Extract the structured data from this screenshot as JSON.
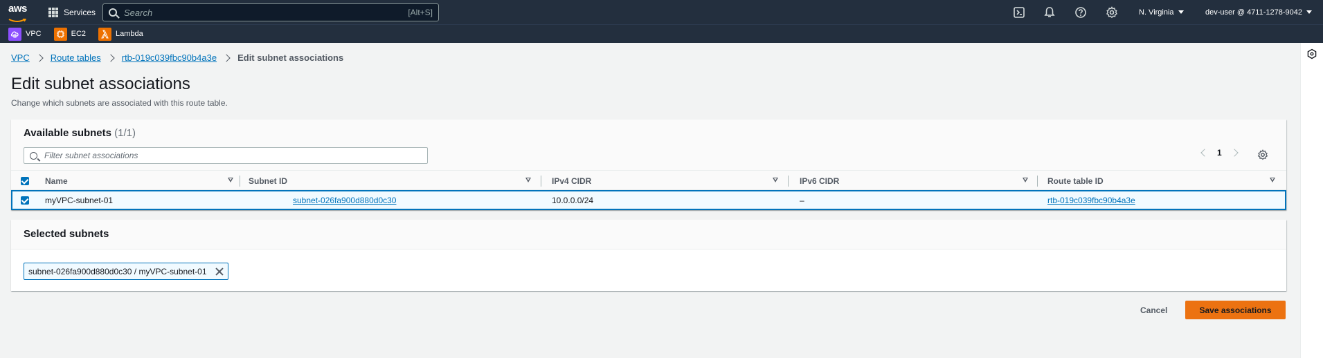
{
  "topnav": {
    "logo_text": "aws",
    "services_label": "Services",
    "search_placeholder": "Search",
    "search_shortcut": "[Alt+S]",
    "region": "N. Virginia",
    "account": "dev-user @ 4711-1278-9042"
  },
  "favorites": [
    {
      "label": "VPC",
      "color": "#8c4fff",
      "icon": "vpc-icon"
    },
    {
      "label": "EC2",
      "color": "#ed7100",
      "icon": "ec2-icon"
    },
    {
      "label": "Lambda",
      "color": "#ed7100",
      "icon": "lambda-icon"
    }
  ],
  "breadcrumbs": {
    "vpc": "VPC",
    "route_tables": "Route tables",
    "route_table_id": "rtb-019c039fbc90b4a3e",
    "current": "Edit subnet associations"
  },
  "page": {
    "title": "Edit subnet associations",
    "description": "Change which subnets are associated with this route table."
  },
  "available": {
    "title": "Available subnets",
    "count": "(1/1)",
    "filter_placeholder": "Filter subnet associations",
    "page_number": "1",
    "columns": [
      "Name",
      "Subnet ID",
      "IPv4 CIDR",
      "IPv6 CIDR",
      "Route table ID"
    ],
    "rows": [
      {
        "name": "myVPC-subnet-01",
        "subnet_id": "subnet-026fa900d880d0c30",
        "ipv4": "10.0.0.0/24",
        "ipv6": "–",
        "route_table_id": "rtb-019c039fbc90b4a3e",
        "selected": true
      }
    ]
  },
  "selected": {
    "title": "Selected subnets",
    "token": "subnet-026fa900d880d0c30 / myVPC-subnet-01"
  },
  "actions": {
    "cancel": "Cancel",
    "save": "Save associations"
  },
  "colors": {
    "nav_bg": "#232f3e",
    "link": "#0073bb",
    "primary_button": "#ec7211"
  }
}
